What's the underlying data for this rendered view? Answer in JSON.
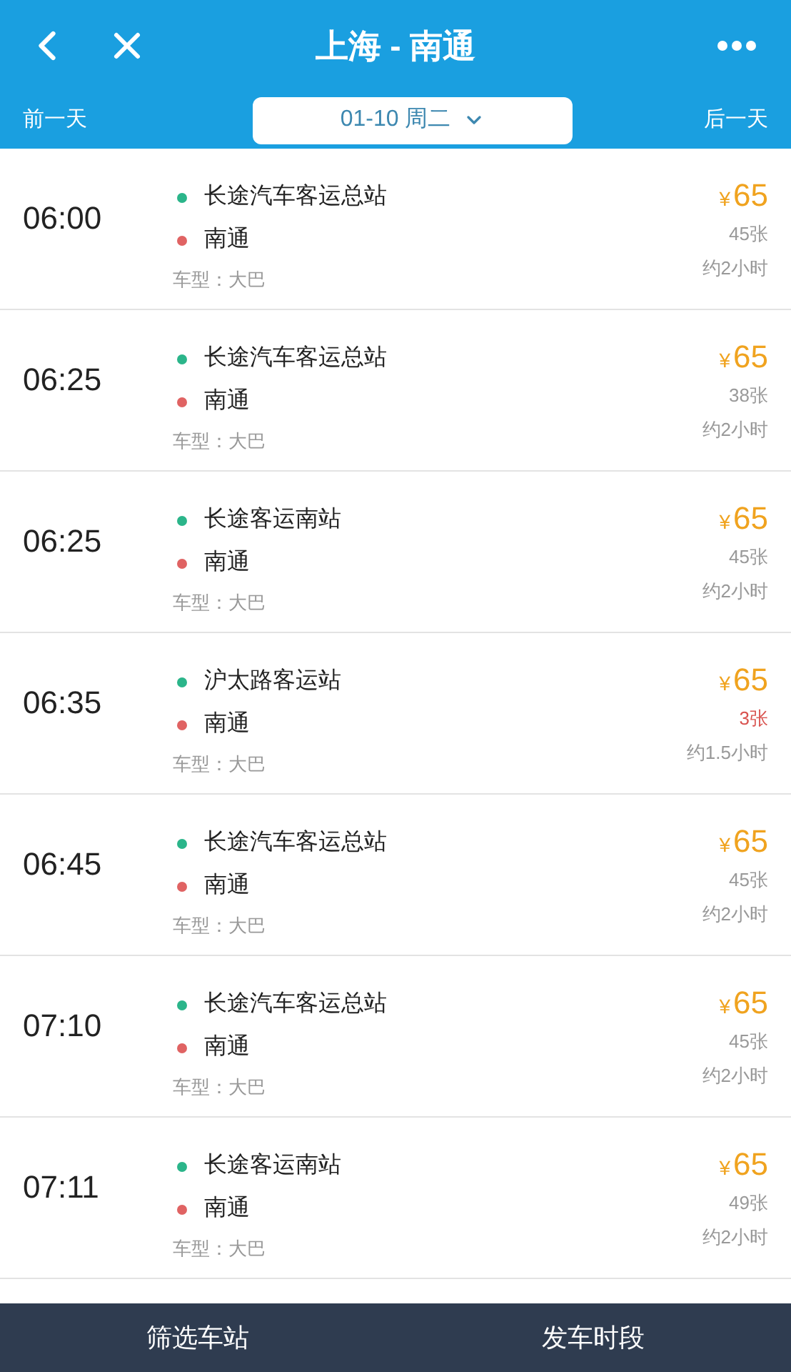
{
  "header": {
    "title": "上海 - 南通",
    "prev_day": "前一天",
    "date": "01-10 周二",
    "next_day": "后一天"
  },
  "trips": [
    {
      "time": "06:00",
      "from": "长途汽车客运总站",
      "to": "南通",
      "vehicle": "车型：大巴",
      "currency": "¥",
      "price": "65",
      "seats": "45张",
      "seats_low": false,
      "duration": "约2小时"
    },
    {
      "time": "06:25",
      "from": "长途汽车客运总站",
      "to": "南通",
      "vehicle": "车型：大巴",
      "currency": "¥",
      "price": "65",
      "seats": "38张",
      "seats_low": false,
      "duration": "约2小时"
    },
    {
      "time": "06:25",
      "from": "长途客运南站",
      "to": "南通",
      "vehicle": "车型：大巴",
      "currency": "¥",
      "price": "65",
      "seats": "45张",
      "seats_low": false,
      "duration": "约2小时"
    },
    {
      "time": "06:35",
      "from": "沪太路客运站",
      "to": "南通",
      "vehicle": "车型：大巴",
      "currency": "¥",
      "price": "65",
      "seats": "3张",
      "seats_low": true,
      "duration": "约1.5小时"
    },
    {
      "time": "06:45",
      "from": "长途汽车客运总站",
      "to": "南通",
      "vehicle": "车型：大巴",
      "currency": "¥",
      "price": "65",
      "seats": "45张",
      "seats_low": false,
      "duration": "约2小时"
    },
    {
      "time": "07:10",
      "from": "长途汽车客运总站",
      "to": "南通",
      "vehicle": "车型：大巴",
      "currency": "¥",
      "price": "65",
      "seats": "45张",
      "seats_low": false,
      "duration": "约2小时"
    },
    {
      "time": "07:11",
      "from": "长途客运南站",
      "to": "南通",
      "vehicle": "车型：大巴",
      "currency": "¥",
      "price": "65",
      "seats": "49张",
      "seats_low": false,
      "duration": "约2小时"
    }
  ],
  "bottom_bar": [
    "筛选车站",
    "发车时段"
  ]
}
